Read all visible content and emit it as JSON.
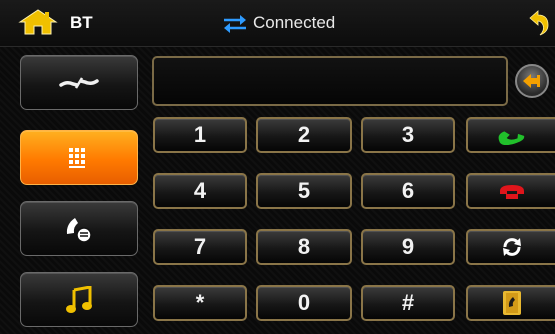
{
  "header": {
    "title": "BT",
    "status": "Connected"
  },
  "sidebar": {
    "items": [
      {
        "name": "link",
        "icon": "bt-link-icon"
      },
      {
        "name": "dialpad",
        "icon": "dialpad-icon",
        "active": true
      },
      {
        "name": "phonebook",
        "icon": "phonebook-icon"
      },
      {
        "name": "music",
        "icon": "music-note-icon"
      }
    ]
  },
  "keypad": {
    "keys": [
      "1",
      "2",
      "3",
      "4",
      "5",
      "6",
      "7",
      "8",
      "9",
      "*",
      "0",
      "#"
    ],
    "actions": [
      "call-icon",
      "hangup-icon",
      "refresh-icon",
      "contacts-icon"
    ]
  },
  "display": {
    "number": ""
  },
  "colors": {
    "accent": "#ff8a00",
    "key_border": "#8a7548",
    "call": "#21c02b",
    "hangup": "#e0151b",
    "backspace_arrow": "#f4a000"
  }
}
